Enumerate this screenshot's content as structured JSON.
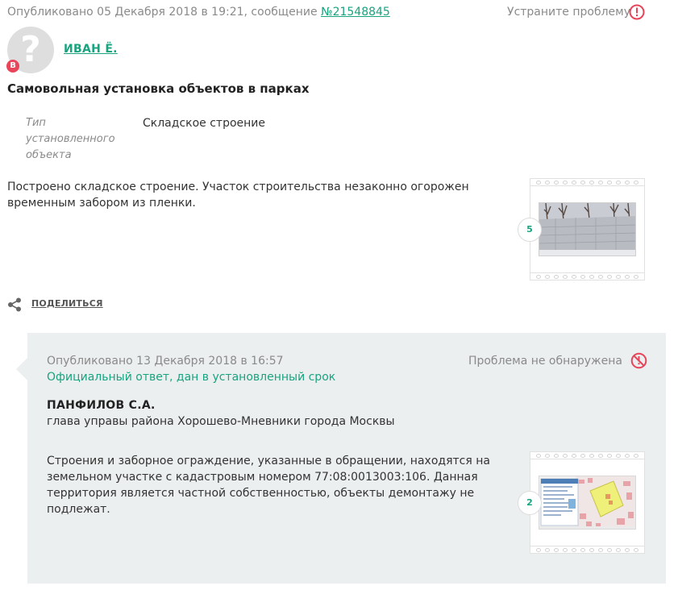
{
  "header": {
    "published_prefix": "Опубликовано 05 Декабря 2018 в 19:21, сообщение ",
    "message_number": "№21548845",
    "status_text": "Устраните проблему",
    "status_icon": "alert-circle-icon",
    "status_color": "#e8445a"
  },
  "author": {
    "avatar_placeholder": "?",
    "badge": "В",
    "name": "ИВАН Ё."
  },
  "issue": {
    "title": "Самовольная установка объектов в парках",
    "property_label": "Тип установленного объекта",
    "property_value": "Складское строение",
    "description": "Построено складское строение. Участок строительства незаконно огорожен временным забором из пленки.",
    "photo_count": "5"
  },
  "share": {
    "icon": "share-icon",
    "label": "ПОДЕЛИТЬСЯ"
  },
  "answer": {
    "published": "Опубликовано 13 Декабря 2018 в 16:57",
    "official": "Официальный ответ, дан в установленный срок",
    "status_text": "Проблема не обнаружена",
    "status_icon": "not-found-icon",
    "name": "ПАНФИЛОВ С.А.",
    "position": "глава управы района Хорошево-Мневники города Москвы",
    "text": "Строения и заборное ограждение, указанные в обращении, находятся на земельном участке с кадастровым номером 77:08:0013003:106. Данная территория является частной собственностью, объекты демонтажу не подлежат.",
    "photo_count": "2"
  },
  "colors": {
    "accent": "#1aa37f",
    "alert": "#e8445a",
    "answer_background": "#eceff0"
  }
}
